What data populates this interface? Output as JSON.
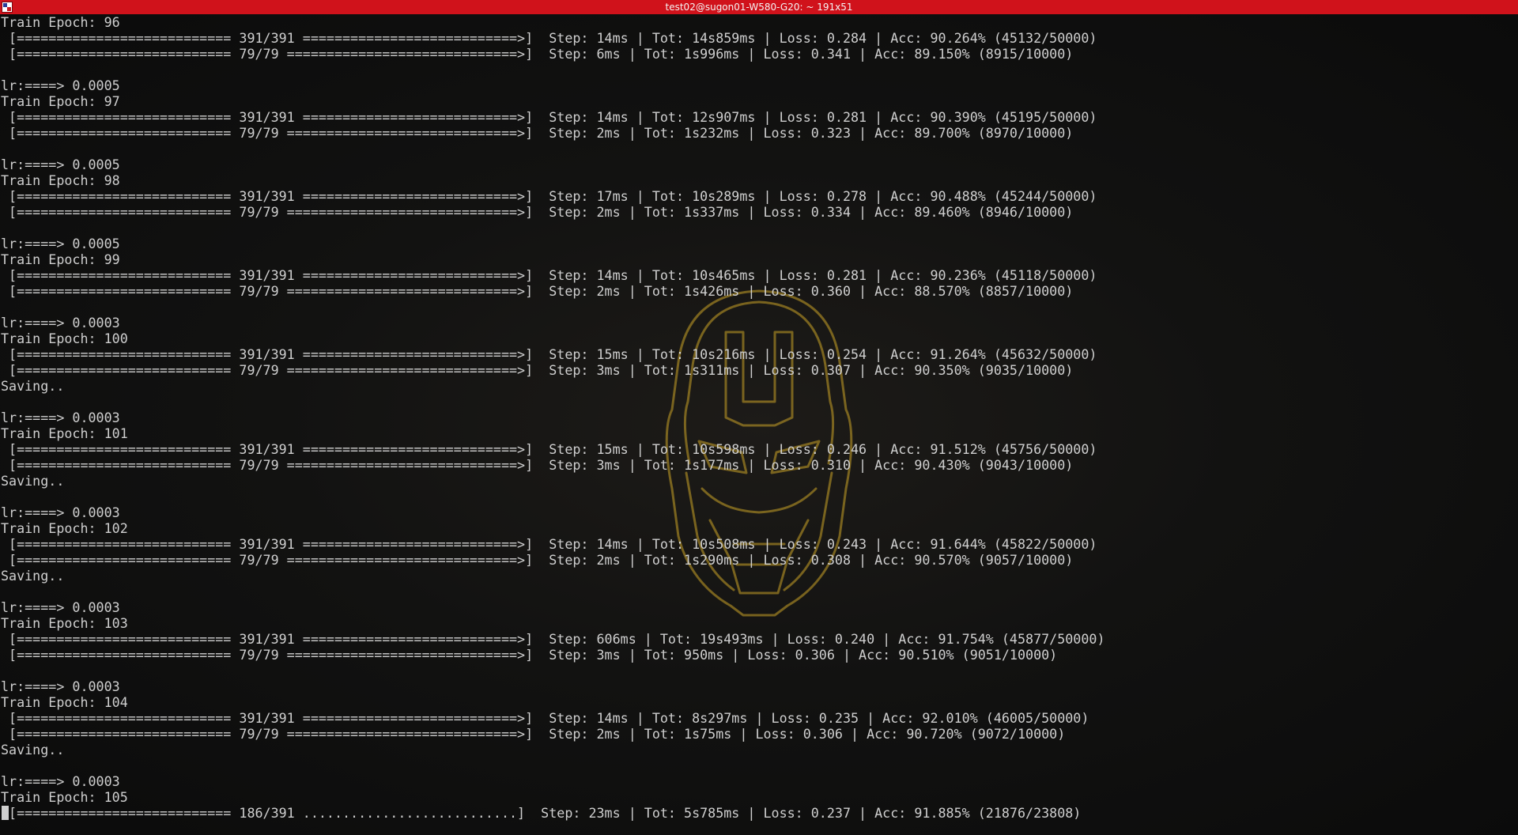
{
  "window": {
    "title": "test02@sugon01-W580-G20: ~ 191x51"
  },
  "terminal": {
    "lines": [
      "Train Epoch: 96",
      " [=========================== 391/391 ===========================>]  Step: 14ms | Tot: 14s859ms | Loss: 0.284 | Acc: 90.264% (45132/50000)",
      " [=========================== 79/79 =============================>]  Step: 6ms | Tot: 1s996ms | Loss: 0.341 | Acc: 89.150% (8915/10000)",
      "",
      "lr:====> 0.0005",
      "Train Epoch: 97",
      " [=========================== 391/391 ===========================>]  Step: 14ms | Tot: 12s907ms | Loss: 0.281 | Acc: 90.390% (45195/50000)",
      " [=========================== 79/79 =============================>]  Step: 2ms | Tot: 1s232ms | Loss: 0.323 | Acc: 89.700% (8970/10000)",
      "",
      "lr:====> 0.0005",
      "Train Epoch: 98",
      " [=========================== 391/391 ===========================>]  Step: 17ms | Tot: 10s289ms | Loss: 0.278 | Acc: 90.488% (45244/50000)",
      " [=========================== 79/79 =============================>]  Step: 2ms | Tot: 1s337ms | Loss: 0.334 | Acc: 89.460% (8946/10000)",
      "",
      "lr:====> 0.0005",
      "Train Epoch: 99",
      " [=========================== 391/391 ===========================>]  Step: 14ms | Tot: 10s465ms | Loss: 0.281 | Acc: 90.236% (45118/50000)",
      " [=========================== 79/79 =============================>]  Step: 2ms | Tot: 1s426ms | Loss: 0.360 | Acc: 88.570% (8857/10000)",
      "",
      "lr:====> 0.0003",
      "Train Epoch: 100",
      " [=========================== 391/391 ===========================>]  Step: 15ms | Tot: 10s216ms | Loss: 0.254 | Acc: 91.264% (45632/50000)",
      " [=========================== 79/79 =============================>]  Step: 3ms | Tot: 1s311ms | Loss: 0.307 | Acc: 90.350% (9035/10000)",
      "Saving..",
      "",
      "lr:====> 0.0003",
      "Train Epoch: 101",
      " [=========================== 391/391 ===========================>]  Step: 15ms | Tot: 10s598ms | Loss: 0.246 | Acc: 91.512% (45756/50000)",
      " [=========================== 79/79 =============================>]  Step: 3ms | Tot: 1s177ms | Loss: 0.310 | Acc: 90.430% (9043/10000)",
      "Saving..",
      "",
      "lr:====> 0.0003",
      "Train Epoch: 102",
      " [=========================== 391/391 ===========================>]  Step: 14ms | Tot: 10s508ms | Loss: 0.243 | Acc: 91.644% (45822/50000)",
      " [=========================== 79/79 =============================>]  Step: 2ms | Tot: 1s290ms | Loss: 0.308 | Acc: 90.570% (9057/10000)",
      "Saving..",
      "",
      "lr:====> 0.0003",
      "Train Epoch: 103",
      " [=========================== 391/391 ===========================>]  Step: 606ms | Tot: 19s493ms | Loss: 0.240 | Acc: 91.754% (45877/50000)",
      " [=========================== 79/79 =============================>]  Step: 3ms | Tot: 950ms | Loss: 0.306 | Acc: 90.510% (9051/10000)",
      "",
      "lr:====> 0.0003",
      "Train Epoch: 104",
      " [=========================== 391/391 ===========================>]  Step: 14ms | Tot: 8s297ms | Loss: 0.235 | Acc: 92.010% (46005/50000)",
      " [=========================== 79/79 =============================>]  Step: 2ms | Tot: 1s75ms | Loss: 0.306 | Acc: 90.720% (9072/10000)",
      "Saving..",
      "",
      "lr:====> 0.0003",
      "Train Epoch: 105",
      " [=========================== 186/391 ...........................]  Step: 23ms | Tot: 5s785ms | Loss: 0.237 | Acc: 91.885% (21876/23808)"
    ]
  },
  "colors": {
    "titlebar": "#d0121b",
    "terminal_background": "#0d0d0d",
    "terminal_text": "#cfcfcf",
    "wallpaper_outline": "#c9a227"
  },
  "icons": {
    "window": "terminal-window-icon",
    "wallpaper": "iron-man-helmet-icon"
  }
}
